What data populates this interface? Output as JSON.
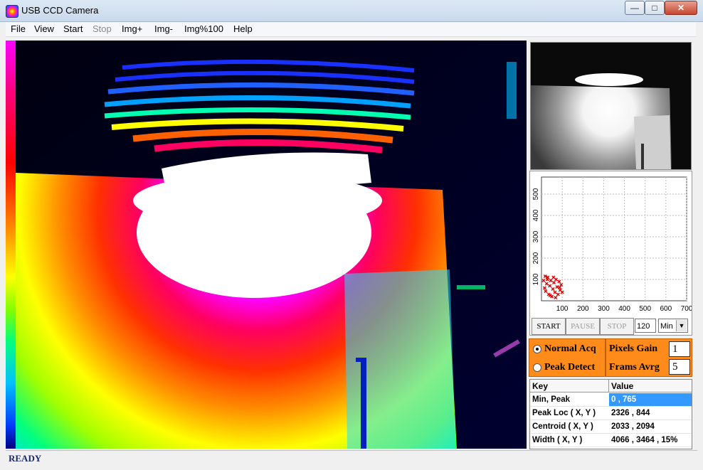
{
  "window": {
    "title": "USB CCD Camera",
    "minimize": "—",
    "maximize": "□",
    "close": "✕"
  },
  "menu": [
    {
      "label": "File",
      "enabled": true
    },
    {
      "label": "View",
      "enabled": true
    },
    {
      "label": "Start",
      "enabled": true
    },
    {
      "label": "Stop",
      "enabled": false
    },
    {
      "label": "Img+",
      "enabled": true
    },
    {
      "label": "Img-",
      "enabled": true
    },
    {
      "label": "Img%100",
      "enabled": true
    },
    {
      "label": "Help",
      "enabled": true
    }
  ],
  "plot": {
    "x_ticks": [
      "100",
      "200",
      "300",
      "400",
      "500",
      "600",
      "700"
    ],
    "y_ticks": [
      "100",
      "200",
      "300",
      "400",
      "500"
    ],
    "xlim": [
      0,
      700
    ],
    "ylim": [
      0,
      580
    ],
    "point_color": "#e00000",
    "points": [
      [
        10,
        95
      ],
      [
        15,
        60
      ],
      [
        20,
        45
      ],
      [
        25,
        80
      ],
      [
        30,
        110
      ],
      [
        35,
        30
      ],
      [
        40,
        70
      ],
      [
        45,
        95
      ],
      [
        50,
        20
      ],
      [
        55,
        55
      ],
      [
        60,
        85
      ],
      [
        65,
        40
      ],
      [
        70,
        100
      ],
      [
        75,
        65
      ],
      [
        80,
        30
      ],
      [
        85,
        90
      ],
      [
        90,
        50
      ],
      [
        95,
        75
      ],
      [
        100,
        40
      ],
      [
        18,
        115
      ],
      [
        42,
        25
      ],
      [
        68,
        15
      ],
      [
        88,
        62
      ],
      [
        28,
        100
      ],
      [
        58,
        110
      ]
    ]
  },
  "controls": {
    "start": "START",
    "pause": "PAUSE",
    "stop": "STOP",
    "time_value": "120",
    "unit": "Min",
    "dropdown_arrow": "▼"
  },
  "acq": {
    "normal_label": "Normal Acq",
    "peak_label": "Peak Detect",
    "selected": "normal",
    "gain_label": "Pixels Gain",
    "gain_value": "1",
    "avg_label": "Frams Avrg",
    "avg_value": "5"
  },
  "table": {
    "headers": [
      "Key",
      "Value"
    ],
    "rows": [
      {
        "key": "Min, Peak",
        "value": "0 , 765"
      },
      {
        "key": "Peak Loc ( X, Y )",
        "value": "2326 , 844"
      },
      {
        "key": "Centroid ( X, Y )",
        "value": "2033 , 2094"
      },
      {
        "key": "Width ( X, Y )",
        "value": "4066 , 3464 , 15%"
      }
    ]
  },
  "status": "READY",
  "colors": {
    "accent_orange": "#ff8c1a",
    "selection_blue": "#3399ff",
    "status_text": "#1a2a6a"
  }
}
